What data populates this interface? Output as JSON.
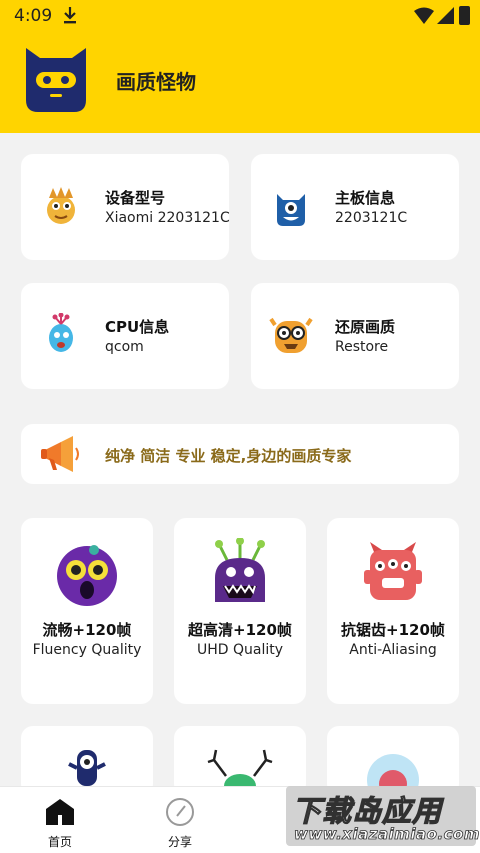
{
  "status_bar": {
    "time": "4:09"
  },
  "header": {
    "title": "画质怪物"
  },
  "info_cards": [
    {
      "label": "设备型号",
      "value": "Xiaomi 2203121C",
      "icon": "yellow-chick-monster-icon"
    },
    {
      "label": "主板信息",
      "value": "2203121C",
      "icon": "blue-monster-icon"
    },
    {
      "label": "CPU信息",
      "value": "qcom",
      "icon": "balloon-monster-icon"
    },
    {
      "label": "还原画质",
      "value": "Restore",
      "icon": "glasses-monster-icon"
    }
  ],
  "banner": {
    "text": "纯净 简洁 专业 稳定,身边的画质专家",
    "icon": "megaphone-icon"
  },
  "mode_cards": [
    {
      "title": "流畅+120帧",
      "subtitle": "Fluency Quality",
      "icon": "purple-eye-monster-icon"
    },
    {
      "title": "超高清+120帧",
      "subtitle": "UHD Quality",
      "icon": "antenna-monster-icon"
    },
    {
      "title": "抗锯齿+120帧",
      "subtitle": "Anti-Aliasing",
      "icon": "red-three-eye-monster-icon"
    }
  ],
  "tabs": [
    {
      "label": "首页",
      "icon": "home-icon",
      "active": true
    },
    {
      "label": "分享",
      "icon": "share-compass-icon",
      "active": false
    }
  ],
  "watermark": {
    "line1": "下载岛应用",
    "line2": "www.xiazaimiao.com"
  },
  "colors": {
    "accent": "#ffd400",
    "background": "#f2f2f2",
    "banner_text": "#8a6a1a"
  }
}
